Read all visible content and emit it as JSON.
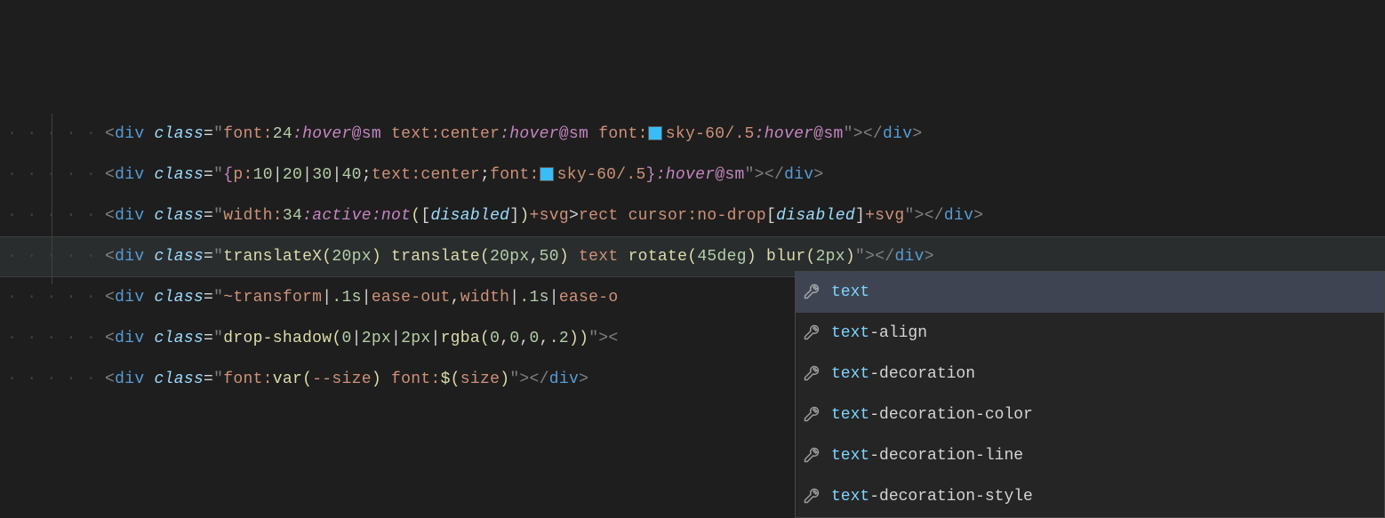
{
  "lines": [
    {
      "tokens": [
        {
          "t": "<",
          "c": "punct"
        },
        {
          "t": "div",
          "c": "tag"
        },
        {
          "t": " ",
          "c": ""
        },
        {
          "t": "class",
          "c": "attr"
        },
        {
          "t": "=",
          "c": "eq"
        },
        {
          "t": "\"",
          "c": "quote"
        },
        {
          "t": "font:",
          "c": "str"
        },
        {
          "t": "24",
          "c": "num"
        },
        {
          "t": ":hover",
          "c": "kw"
        },
        {
          "t": "@sm",
          "c": "at"
        },
        {
          "t": " ",
          "c": ""
        },
        {
          "t": "text:center",
          "c": "str"
        },
        {
          "t": ":hover",
          "c": "kw"
        },
        {
          "t": "@sm",
          "c": "at"
        },
        {
          "t": " ",
          "c": ""
        },
        {
          "t": "font:",
          "c": "str"
        },
        {
          "swatch": true
        },
        {
          "t": "sky-60/.5",
          "c": "str"
        },
        {
          "t": ":hover",
          "c": "kw"
        },
        {
          "t": "@sm",
          "c": "at"
        },
        {
          "t": "\"",
          "c": "quote"
        },
        {
          "t": ">",
          "c": "punct"
        },
        {
          "t": "</",
          "c": "punct"
        },
        {
          "t": "div",
          "c": "tag"
        },
        {
          "t": ">",
          "c": "punct"
        }
      ]
    },
    {
      "tokens": [
        {
          "t": "<",
          "c": "punct"
        },
        {
          "t": "div",
          "c": "tag"
        },
        {
          "t": " ",
          "c": ""
        },
        {
          "t": "class",
          "c": "attr"
        },
        {
          "t": "=",
          "c": "eq"
        },
        {
          "t": "\"",
          "c": "quote"
        },
        {
          "t": "{",
          "c": "brace"
        },
        {
          "t": "p:",
          "c": "str"
        },
        {
          "t": "10",
          "c": "num"
        },
        {
          "t": "|",
          "c": "pipe"
        },
        {
          "t": "20",
          "c": "num"
        },
        {
          "t": "|",
          "c": "pipe"
        },
        {
          "t": "30",
          "c": "num"
        },
        {
          "t": "|",
          "c": "pipe"
        },
        {
          "t": "40",
          "c": "num"
        },
        {
          "t": ";",
          "c": "op"
        },
        {
          "t": "text:center",
          "c": "str"
        },
        {
          "t": ";",
          "c": "op"
        },
        {
          "t": "font:",
          "c": "str"
        },
        {
          "swatch": true
        },
        {
          "t": "sky-60/.5",
          "c": "str"
        },
        {
          "t": "}",
          "c": "brace"
        },
        {
          "t": ":hover",
          "c": "kw"
        },
        {
          "t": "@sm",
          "c": "at"
        },
        {
          "t": "\"",
          "c": "quote"
        },
        {
          "t": ">",
          "c": "punct"
        },
        {
          "t": "</",
          "c": "punct"
        },
        {
          "t": "div",
          "c": "tag"
        },
        {
          "t": ">",
          "c": "punct"
        }
      ]
    },
    {
      "tokens": [
        {
          "t": "<",
          "c": "punct"
        },
        {
          "t": "div",
          "c": "tag"
        },
        {
          "t": " ",
          "c": ""
        },
        {
          "t": "class",
          "c": "attr"
        },
        {
          "t": "=",
          "c": "eq"
        },
        {
          "t": "\"",
          "c": "quote"
        },
        {
          "t": "width:",
          "c": "str"
        },
        {
          "t": "34",
          "c": "num"
        },
        {
          "t": ":active",
          "c": "kw"
        },
        {
          "t": ":not",
          "c": "kw"
        },
        {
          "t": "(",
          "c": "paren"
        },
        {
          "t": "[",
          "c": "op"
        },
        {
          "t": "disabled",
          "c": "attr"
        },
        {
          "t": "]",
          "c": "op"
        },
        {
          "t": ")",
          "c": "paren"
        },
        {
          "t": "+svg",
          "c": "str"
        },
        {
          "t": ">",
          "c": "op"
        },
        {
          "t": "rect",
          "c": "str"
        },
        {
          "t": " ",
          "c": ""
        },
        {
          "t": "cursor:no-drop",
          "c": "str"
        },
        {
          "t": "[",
          "c": "op"
        },
        {
          "t": "disabled",
          "c": "attr"
        },
        {
          "t": "]",
          "c": "op"
        },
        {
          "t": "+svg",
          "c": "str"
        },
        {
          "t": "\"",
          "c": "quote"
        },
        {
          "t": ">",
          "c": "punct"
        },
        {
          "t": "</",
          "c": "punct"
        },
        {
          "t": "div",
          "c": "tag"
        },
        {
          "t": ">",
          "c": "punct"
        }
      ]
    },
    {
      "highlighted": true,
      "tokens": [
        {
          "t": "<",
          "c": "punct"
        },
        {
          "t": "div",
          "c": "tag"
        },
        {
          "t": " ",
          "c": ""
        },
        {
          "t": "class",
          "c": "attr"
        },
        {
          "t": "=",
          "c": "eq"
        },
        {
          "t": "\"",
          "c": "quote"
        },
        {
          "t": "translateX",
          "c": "fn"
        },
        {
          "t": "(",
          "c": "paren"
        },
        {
          "t": "20px",
          "c": "num"
        },
        {
          "t": ")",
          "c": "paren"
        },
        {
          "t": " ",
          "c": ""
        },
        {
          "t": "translate",
          "c": "fn"
        },
        {
          "t": "(",
          "c": "paren"
        },
        {
          "t": "20px",
          "c": "num"
        },
        {
          "t": ",",
          "c": "op"
        },
        {
          "t": "50",
          "c": "num"
        },
        {
          "t": ")",
          "c": "paren"
        },
        {
          "t": " ",
          "c": ""
        },
        {
          "t": "text",
          "c": "str"
        },
        {
          "t": " ",
          "c": ""
        },
        {
          "t": "rotate",
          "c": "fn"
        },
        {
          "t": "(",
          "c": "paren"
        },
        {
          "t": "45deg",
          "c": "num"
        },
        {
          "t": ")",
          "c": "paren"
        },
        {
          "t": " ",
          "c": ""
        },
        {
          "t": "blur",
          "c": "fn"
        },
        {
          "t": "(",
          "c": "paren"
        },
        {
          "t": "2px",
          "c": "num"
        },
        {
          "t": ")",
          "c": "paren"
        },
        {
          "t": "\"",
          "c": "quote"
        },
        {
          "t": ">",
          "c": "punct"
        },
        {
          "t": "</",
          "c": "punct"
        },
        {
          "t": "div",
          "c": "tag"
        },
        {
          "t": ">",
          "c": "punct"
        }
      ]
    },
    {
      "tokens": [
        {
          "t": "<",
          "c": "punct"
        },
        {
          "t": "div",
          "c": "tag"
        },
        {
          "t": " ",
          "c": ""
        },
        {
          "t": "class",
          "c": "attr"
        },
        {
          "t": "=",
          "c": "eq"
        },
        {
          "t": "\"",
          "c": "quote"
        },
        {
          "t": "~transform",
          "c": "str"
        },
        {
          "t": "|",
          "c": "pipe"
        },
        {
          "t": ".1s",
          "c": "num"
        },
        {
          "t": "|",
          "c": "pipe"
        },
        {
          "t": "ease-out",
          "c": "str"
        },
        {
          "t": ",",
          "c": "op"
        },
        {
          "t": "width",
          "c": "str"
        },
        {
          "t": "|",
          "c": "pipe"
        },
        {
          "t": ".1s",
          "c": "num"
        },
        {
          "t": "|",
          "c": "pipe"
        },
        {
          "t": "ease-o",
          "c": "str"
        }
      ]
    },
    {
      "tokens": [
        {
          "t": "<",
          "c": "punct"
        },
        {
          "t": "div",
          "c": "tag"
        },
        {
          "t": " ",
          "c": ""
        },
        {
          "t": "class",
          "c": "attr"
        },
        {
          "t": "=",
          "c": "eq"
        },
        {
          "t": "\"",
          "c": "quote"
        },
        {
          "t": "drop-shadow",
          "c": "fn"
        },
        {
          "t": "(",
          "c": "paren"
        },
        {
          "t": "0",
          "c": "num"
        },
        {
          "t": "|",
          "c": "pipe"
        },
        {
          "t": "2px",
          "c": "num"
        },
        {
          "t": "|",
          "c": "pipe"
        },
        {
          "t": "2px",
          "c": "num"
        },
        {
          "t": "|",
          "c": "pipe"
        },
        {
          "t": "rgba",
          "c": "fn"
        },
        {
          "t": "(",
          "c": "paren"
        },
        {
          "t": "0",
          "c": "num"
        },
        {
          "t": ",",
          "c": "op"
        },
        {
          "t": "0",
          "c": "num"
        },
        {
          "t": ",",
          "c": "op"
        },
        {
          "t": "0",
          "c": "num"
        },
        {
          "t": ",",
          "c": "op"
        },
        {
          "t": ".2",
          "c": "num"
        },
        {
          "t": ")",
          "c": "paren"
        },
        {
          "t": ")",
          "c": "paren"
        },
        {
          "t": "\"",
          "c": "quote"
        },
        {
          "t": ">",
          "c": "punct"
        },
        {
          "t": "<",
          "c": "punct"
        }
      ]
    },
    {
      "tokens": [
        {
          "t": "<",
          "c": "punct"
        },
        {
          "t": "div",
          "c": "tag"
        },
        {
          "t": " ",
          "c": ""
        },
        {
          "t": "class",
          "c": "attr"
        },
        {
          "t": "=",
          "c": "eq"
        },
        {
          "t": "\"",
          "c": "quote"
        },
        {
          "t": "font:",
          "c": "str"
        },
        {
          "t": "var",
          "c": "fn"
        },
        {
          "t": "(",
          "c": "paren"
        },
        {
          "t": "--size",
          "c": "str"
        },
        {
          "t": ")",
          "c": "paren"
        },
        {
          "t": " ",
          "c": ""
        },
        {
          "t": "font:",
          "c": "str"
        },
        {
          "t": "$",
          "c": "fn"
        },
        {
          "t": "(",
          "c": "paren"
        },
        {
          "t": "size",
          "c": "str"
        },
        {
          "t": ")",
          "c": "paren"
        },
        {
          "t": "\"",
          "c": "quote"
        },
        {
          "t": ">",
          "c": "punct"
        },
        {
          "t": "</",
          "c": "punct"
        },
        {
          "t": "div",
          "c": "tag"
        },
        {
          "t": ">",
          "c": "punct"
        }
      ]
    }
  ],
  "indent_dots": "· · · · · ",
  "autocomplete": {
    "items": [
      {
        "match": "text",
        "rest": "",
        "selected": true
      },
      {
        "match": "text",
        "rest": "-align"
      },
      {
        "match": "text",
        "rest": "-decoration"
      },
      {
        "match": "text",
        "rest": "-decoration-color"
      },
      {
        "match": "text",
        "rest": "-decoration-line"
      },
      {
        "match": "text",
        "rest": "-decoration-style"
      }
    ]
  }
}
